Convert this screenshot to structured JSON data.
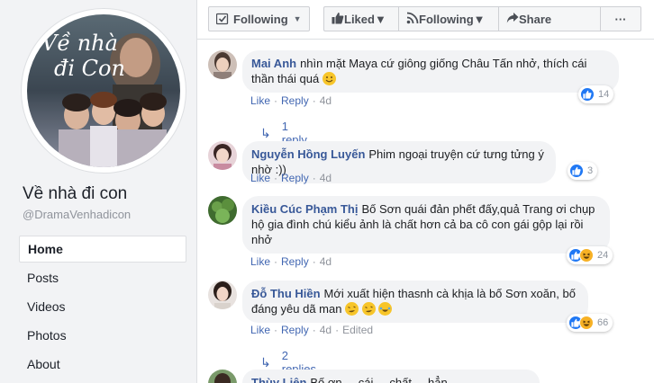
{
  "page": {
    "name": "Về nhà đi con",
    "handle": "@DramaVenhadicon",
    "avatar_title_line1": "Về nhà",
    "avatar_title_line2": "đi Con"
  },
  "nav": {
    "items": [
      {
        "label": "Home",
        "active": true
      },
      {
        "label": "Posts"
      },
      {
        "label": "Videos"
      },
      {
        "label": "Photos"
      },
      {
        "label": "About"
      }
    ]
  },
  "actionbar": {
    "following_label": "Following",
    "liked_label": "Liked",
    "following2_label": "Following",
    "share_label": "Share",
    "more_label": "···"
  },
  "comments": [
    {
      "author": "Mai Anh",
      "text_line1": "nhìn mặt Maya cứ giông giống Châu Tấn nhở, thích cái",
      "text_line2": "thần thái quá",
      "like": "Like",
      "reply": "Reply",
      "time": "4d",
      "reaction_count": "14",
      "replies": "1 reply"
    },
    {
      "author": "Nguyễn Hồng Luyến",
      "text_line1": "Phim ngoại truyện cứ tưng tửng ý nhờ :))",
      "like": "Like",
      "reply": "Reply",
      "time": "4d",
      "reaction_count": "3"
    },
    {
      "author": "Kiều Cúc Phạm Thị",
      "text_line1": "Bố Sơn quái đản phết đấy,quả Trang ơi chụp",
      "text_line2": "hộ gia đình chú kiểu ảnh là chất hơn cả ba cô con gái gộp lại rồi",
      "text_line3": "nhở",
      "like": "Like",
      "reply": "Reply",
      "time": "4d",
      "reaction_count": "24"
    },
    {
      "author": "Đỗ Thu Hiền",
      "text_line1": "Mới xuất hiện thasnh cà khịa là bố Sơn xoăn, bố",
      "text_line2": "đáng yêu dã man",
      "like": "Like",
      "reply": "Reply",
      "time": "4d",
      "edited": "Edited",
      "reaction_count": "66",
      "replies": "2 replies"
    },
    {
      "author": "Thùy Liên",
      "text_line1": "Bố ơn ... cái ... chất ... hẳn ... ",
      "partial": true
    }
  ],
  "colors": {
    "link": "#385898",
    "action_link": "#4267b2",
    "bubble": "#f2f3f5",
    "like_blue": "#2078f4",
    "haha_yellow": "#f7b125"
  }
}
